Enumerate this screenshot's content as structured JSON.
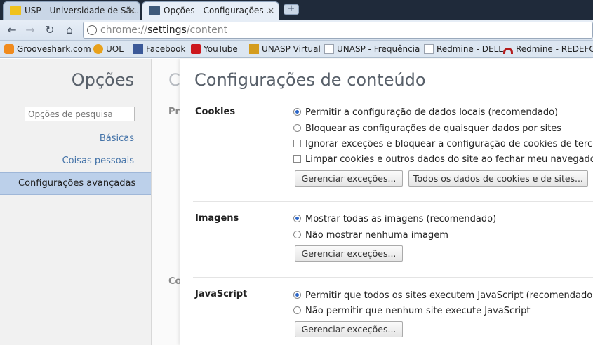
{
  "tabs": [
    {
      "title": "USP - Universidade de Sã...",
      "close": "×"
    },
    {
      "title": "Opções - Configurações ...",
      "close": "×"
    }
  ],
  "new_tab": "+",
  "toolbar": {
    "back": "←",
    "forward": "→",
    "reload": "↻",
    "home": "⌂",
    "url_scheme": "chrome://",
    "url_host": "settings",
    "url_path": "/content"
  },
  "bookmarks": [
    {
      "label": "Grooveshark.com",
      "icon": "grooveshark-icon",
      "color": "#f08b1e"
    },
    {
      "label": "UOL",
      "icon": "uol-icon",
      "color": "#e8a11b"
    },
    {
      "label": "Facebook",
      "icon": "facebook-icon",
      "color": "#3b5998"
    },
    {
      "label": "YouTube",
      "icon": "youtube-icon",
      "color": "#cc181e"
    },
    {
      "label": "UNASP Virtual",
      "icon": "unasp-icon",
      "color": "#d49c1e"
    },
    {
      "label": "UNASP - Frequência",
      "icon": "page-icon",
      "color": "#c9ced6"
    },
    {
      "label": "Redmine - DELL",
      "icon": "page-icon",
      "color": "#c9ced6"
    },
    {
      "label": "Redmine - REDEFOR",
      "icon": "redmine-icon",
      "color": "#b31b1b"
    }
  ],
  "sidebar": {
    "title": "Opções",
    "search_placeholder": "Opções de pesquisa",
    "items": [
      "Básicas",
      "Coisas pessoais",
      "Configurações avançadas"
    ]
  },
  "background": {
    "letter": "C",
    "frag1": "Pr",
    "frag2": "Co"
  },
  "content": {
    "title": "Configurações de conteúdo",
    "sections": {
      "cookies": {
        "heading": "Cookies",
        "options": [
          "Permitir a configuração de dados locais (recomendado)",
          "Bloquear as configurações de quaisquer dados por sites",
          "Ignorar exceções e bloquear a configuração de cookies de terceiros",
          "Limpar cookies e outros dados do site ao fechar meu navegador"
        ],
        "buttons": [
          "Gerenciar exceções...",
          "Todos os dados de cookies e de sites..."
        ]
      },
      "images": {
        "heading": "Imagens",
        "options": [
          "Mostrar todas as imagens (recomendado)",
          "Não mostrar nenhuma imagem"
        ],
        "button": "Gerenciar exceções..."
      },
      "javascript": {
        "heading": "JavaScript",
        "options": [
          "Permitir que todos os sites executem JavaScript (recomendado)",
          "Não permitir que nenhum site execute JavaScript"
        ],
        "button": "Gerenciar exceções..."
      }
    }
  }
}
